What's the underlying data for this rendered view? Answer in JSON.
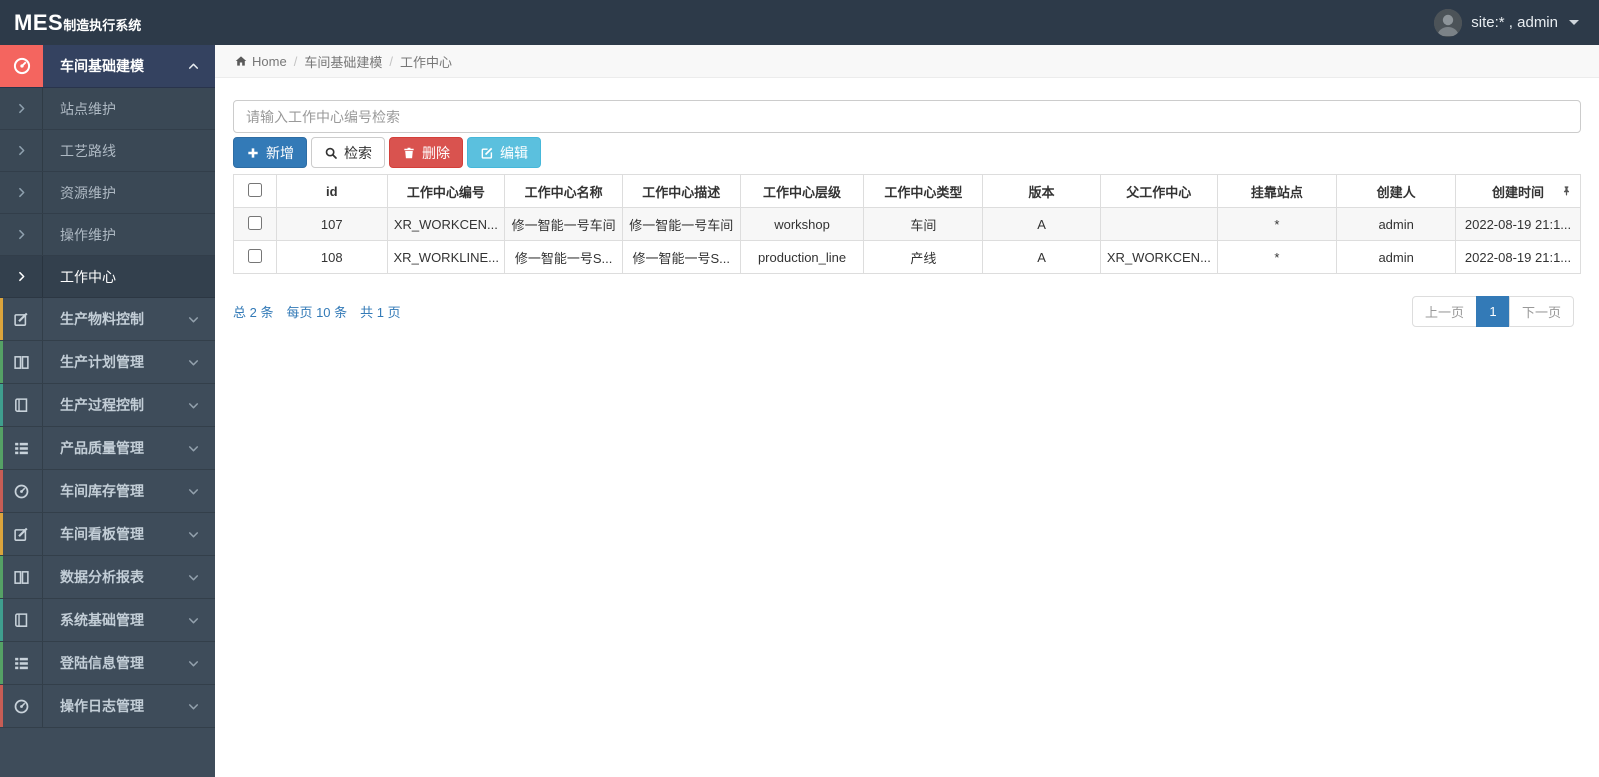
{
  "navbar": {
    "logo_mes": "MES",
    "logo_suffix": "制造执行系统",
    "user_label": "site:* , admin"
  },
  "breadcrumb": {
    "home": "Home",
    "separator": "/",
    "items": [
      "车间基础建模",
      "工作中心"
    ]
  },
  "sidebar": {
    "group": {
      "label": "车间基础建模",
      "icon": "dashboard-icon"
    },
    "subitems": [
      {
        "label": "站点维护",
        "active": false
      },
      {
        "label": "工艺路线",
        "active": false
      },
      {
        "label": "资源维护",
        "active": false
      },
      {
        "label": "操作维护",
        "active": false
      },
      {
        "label": "工作中心",
        "active": true
      }
    ],
    "items": [
      {
        "label": "生产物料控制",
        "icon": "edit-icon",
        "accent": "#dba43c"
      },
      {
        "label": "生产计划管理",
        "icon": "columns-icon",
        "accent": "#55a165"
      },
      {
        "label": "生产过程控制",
        "icon": "book-icon",
        "accent": "#3f9e8e"
      },
      {
        "label": "产品质量管理",
        "icon": "list-icon",
        "accent": "#55a165"
      },
      {
        "label": "车间库存管理",
        "icon": "dashboard-icon",
        "accent": "#c75d55"
      },
      {
        "label": "车间看板管理",
        "icon": "edit-icon",
        "accent": "#dba43c"
      },
      {
        "label": "数据分析报表",
        "icon": "columns-icon",
        "accent": "#55a165"
      },
      {
        "label": "系统基础管理",
        "icon": "book-icon",
        "accent": "#3f9e8e"
      },
      {
        "label": "登陆信息管理",
        "icon": "list-icon",
        "accent": "#55a165"
      },
      {
        "label": "操作日志管理",
        "icon": "dashboard-icon",
        "accent": "#c75d55"
      }
    ]
  },
  "toolbar": {
    "search_placeholder": "请输入工作中心编号检索",
    "buttons": [
      {
        "label": "新增",
        "icon": "plus-icon",
        "style": "primary"
      },
      {
        "label": "检索",
        "icon": "search-icon",
        "style": "default"
      },
      {
        "label": "删除",
        "icon": "trash-icon",
        "style": "danger"
      },
      {
        "label": "编辑",
        "icon": "edit-square-icon",
        "style": "info"
      }
    ]
  },
  "table": {
    "columns": [
      "id",
      "工作中心编号",
      "工作中心名称",
      "工作中心描述",
      "工作中心层级",
      "工作中心类型",
      "版本",
      "父工作中心",
      "挂靠站点",
      "创建人",
      "创建时间"
    ],
    "rows": [
      [
        "107",
        "XR_WORKCEN...",
        "修一智能一号车间",
        "修一智能一号车间",
        "workshop",
        "车间",
        "A",
        "",
        "*",
        "admin",
        "2022-08-19 21:1..."
      ],
      [
        "108",
        "XR_WORKLINE...",
        "修一智能一号S...",
        "修一智能一号S...",
        "production_line",
        "产线",
        "A",
        "XR_WORKCEN...",
        "*",
        "admin",
        "2022-08-19 21:1..."
      ]
    ]
  },
  "footer": {
    "summary": [
      "总 2 条",
      "每页 10 条",
      "共 1 页"
    ],
    "pagination": {
      "prev": "上一页",
      "page": "1",
      "next": "下一页"
    }
  },
  "colors": {
    "navbar_bg": "#2d3a49",
    "sidebar_bg": "#3e4c5a",
    "group_icon_bg": "#f4655f",
    "primary": "#337ab7",
    "danger": "#d9534f",
    "info": "#5bc0de"
  }
}
